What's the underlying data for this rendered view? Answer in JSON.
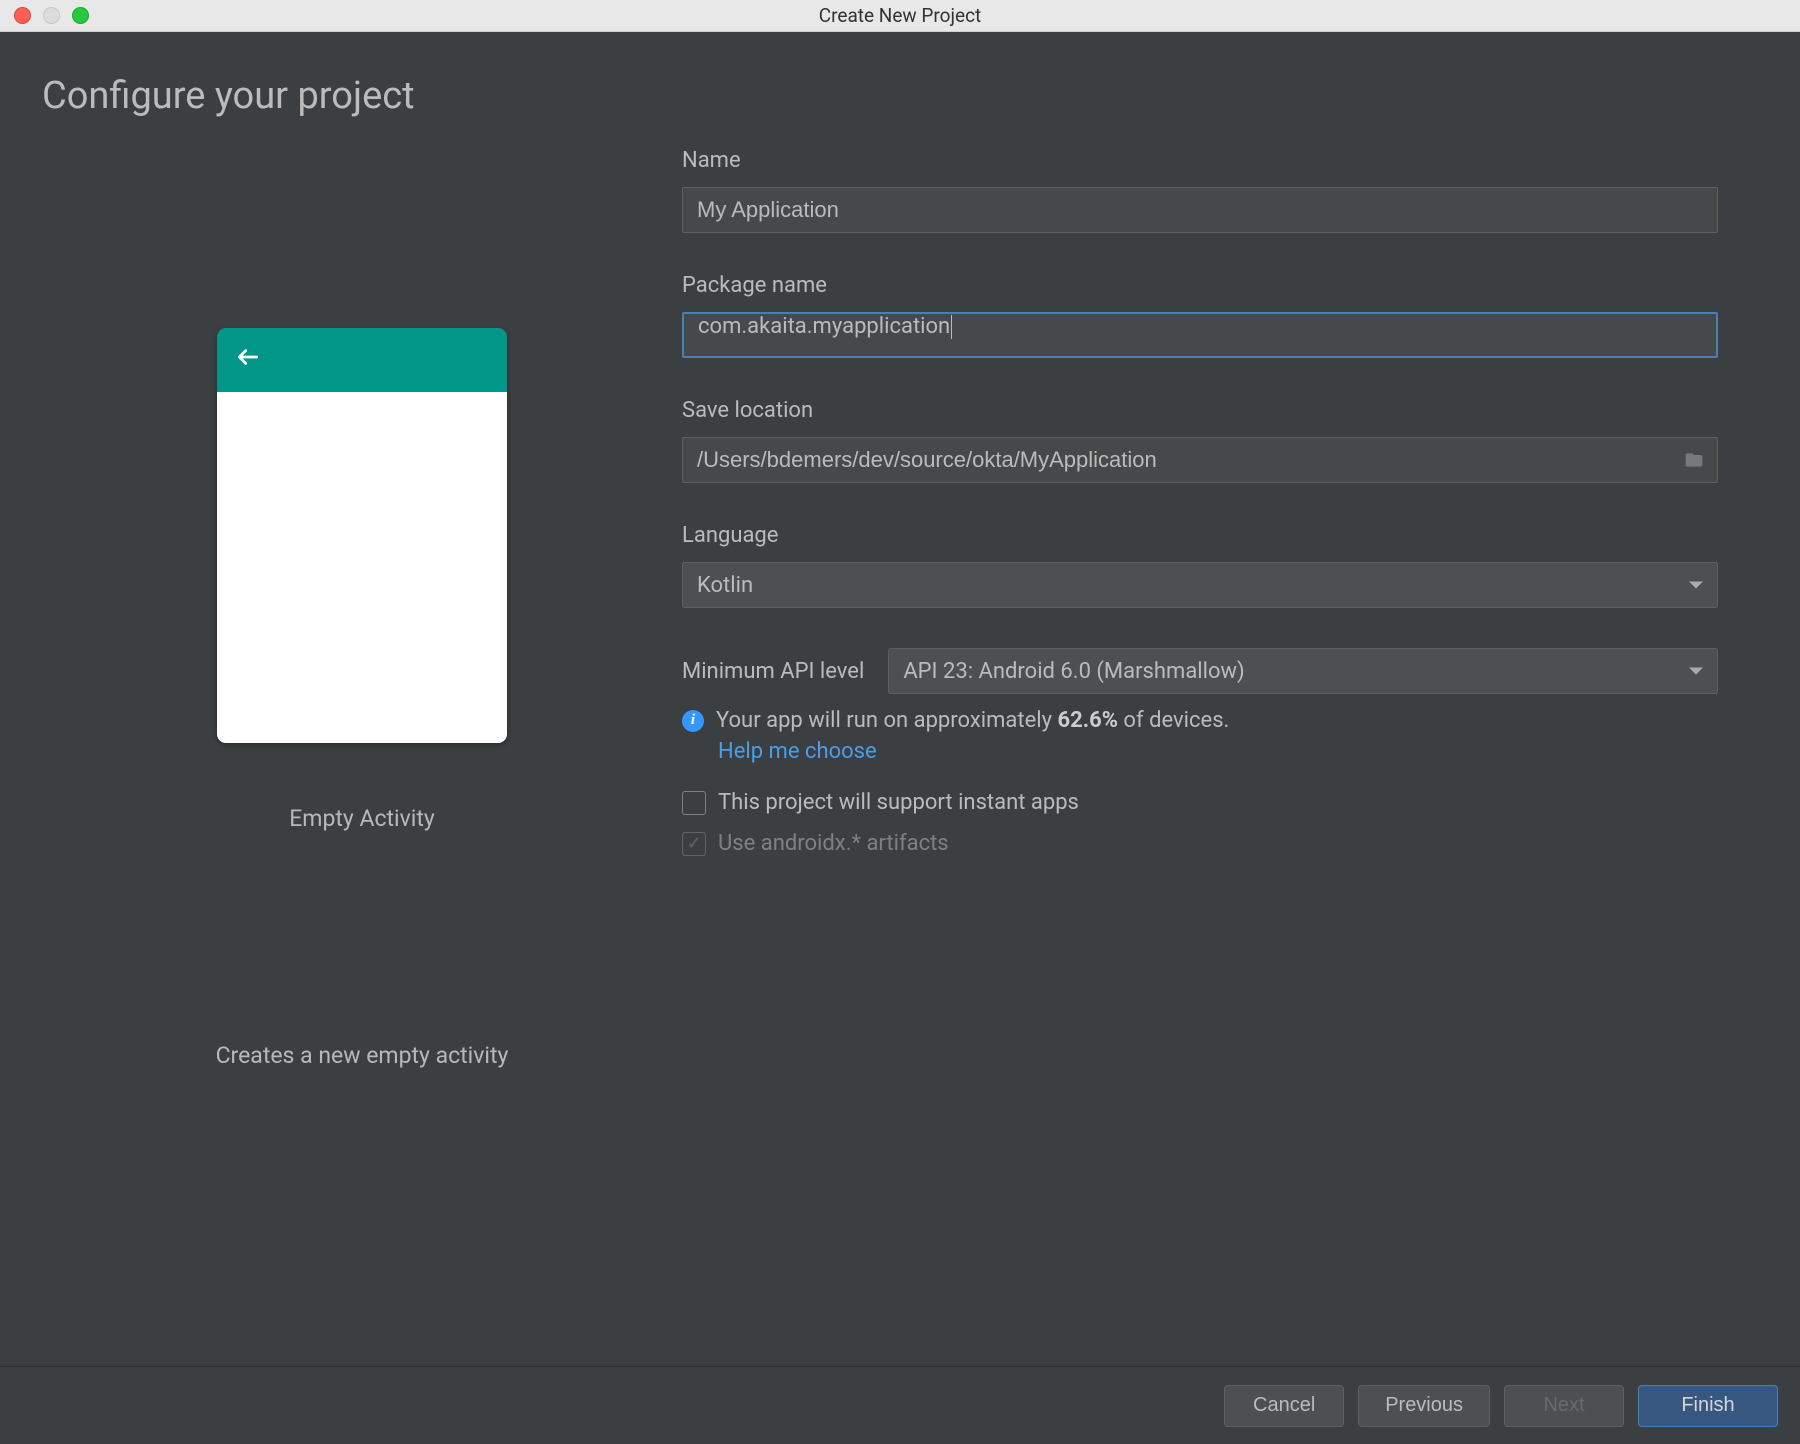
{
  "window": {
    "title": "Create New Project"
  },
  "header": {
    "title": "Configure your project"
  },
  "template": {
    "name": "Empty Activity",
    "description": "Creates a new empty activity"
  },
  "form": {
    "name_label": "Name",
    "name_value": "My Application",
    "package_label": "Package name",
    "package_value": "com.akaita.myapplication",
    "location_label": "Save location",
    "location_value": "/Users/bdemers/dev/source/okta/MyApplication",
    "language_label": "Language",
    "language_value": "Kotlin",
    "api_label": "Minimum API level",
    "api_value": "API 23: Android 6.0 (Marshmallow)",
    "info_prefix": "Your app will run on approximately ",
    "info_percent": "62.6%",
    "info_suffix": " of devices.",
    "help_link": "Help me choose",
    "instant_apps_label": "This project will support instant apps",
    "androidx_label": "Use androidx.* artifacts"
  },
  "buttons": {
    "cancel": "Cancel",
    "previous": "Previous",
    "next": "Next",
    "finish": "Finish"
  }
}
